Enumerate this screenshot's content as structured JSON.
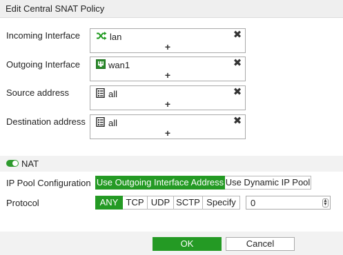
{
  "dialog": {
    "title": "Edit Central SNAT Policy"
  },
  "fields": [
    {
      "label": "Incoming Interface",
      "value": "lan",
      "icon": "shuffle-icon",
      "remove": "✖",
      "add": "+"
    },
    {
      "label": "Outgoing Interface",
      "value": "wan1",
      "icon": "port-icon",
      "remove": "✖",
      "add": "+"
    },
    {
      "label": "Source address",
      "value": "all",
      "icon": "address-icon",
      "remove": "✖",
      "add": "+"
    },
    {
      "label": "Destination address",
      "value": "all",
      "icon": "address-icon",
      "remove": "✖",
      "add": "+"
    }
  ],
  "nat": {
    "label": "NAT",
    "enabled": true
  },
  "ip_pool": {
    "label": "IP Pool Configuration",
    "options": [
      "Use Outgoing Interface Address",
      "Use Dynamic IP Pool"
    ],
    "selected": "Use Outgoing Interface Address"
  },
  "protocol": {
    "label": "Protocol",
    "options": [
      "ANY",
      "TCP",
      "UDP",
      "SCTP",
      "Specify"
    ],
    "selected": "ANY",
    "number": "0"
  },
  "buttons": {
    "ok": "OK",
    "cancel": "Cancel"
  },
  "colors": {
    "accent": "#249a24",
    "shuffle_icon": "#1f9a1f"
  }
}
